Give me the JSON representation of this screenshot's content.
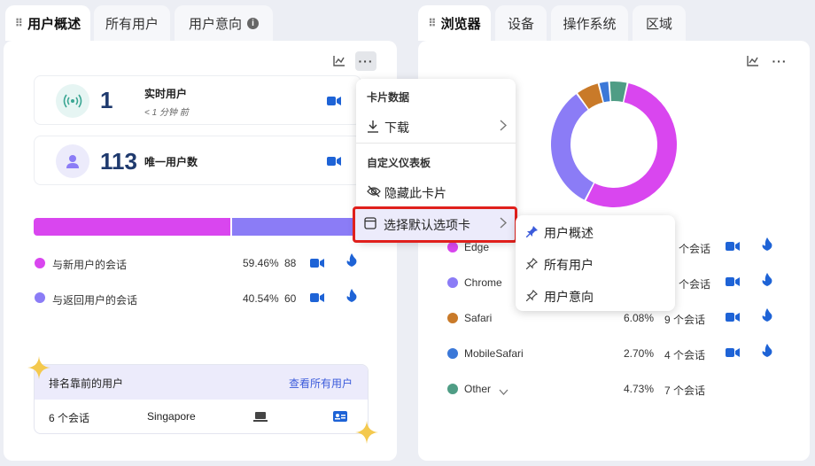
{
  "left_tabs": [
    {
      "label": "用户概述",
      "active": true
    },
    {
      "label": "所有用户",
      "active": false
    },
    {
      "label": "用户意向",
      "active": false
    }
  ],
  "right_tabs": [
    {
      "label": "浏览器",
      "active": true
    },
    {
      "label": "设备",
      "active": false
    },
    {
      "label": "操作系统",
      "active": false
    },
    {
      "label": "区域",
      "active": false
    }
  ],
  "left_card": {
    "realtime": {
      "value": "1",
      "label": "实时用户",
      "sub": "< 1 分钟 前"
    },
    "unique": {
      "value": "113",
      "label": "唯一用户数"
    },
    "bar": {
      "new_share": 59.46,
      "return_share": 40.54,
      "new_color": "#d946ef",
      "return_color": "#8b7cf6"
    },
    "legend": [
      {
        "label": "与新用户的会话",
        "percent": "59.46%",
        "count": "88",
        "color": "#d946ef"
      },
      {
        "label": "与返回用户的会话",
        "percent": "40.54%",
        "count": "60",
        "color": "#8b7cf6"
      }
    ],
    "top_users": {
      "title": "排名靠前的用户",
      "link": "查看所有用户",
      "row": {
        "sessions": "6 个会话",
        "location": "Singapore"
      }
    }
  },
  "right_card": {
    "browsers": [
      {
        "name": "Edge",
        "percent": "",
        "sessions": "个会话",
        "color": "#d946ef"
      },
      {
        "name": "Chrome",
        "percent": "",
        "sessions": "个会话",
        "color": "#8b7cf6"
      },
      {
        "name": "Safari",
        "percent": "6.08%",
        "sessions": "9 个会话",
        "color": "#c97a29"
      },
      {
        "name": "MobileSafari",
        "percent": "2.70%",
        "sessions": "4 个会话",
        "color": "#3b78d8"
      },
      {
        "name": "Other",
        "percent": "4.73%",
        "sessions": "7 个会话",
        "color": "#4f9d85"
      }
    ],
    "donut_shares": [
      54.05,
      32.43,
      6.08,
      2.7,
      4.73
    ]
  },
  "menu": {
    "section1": "卡片数据",
    "download": "下载",
    "section2": "自定义仪表板",
    "hide": "隐藏此卡片",
    "select_default": "选择默认选项卡"
  },
  "submenu": [
    "用户概述",
    "所有用户",
    "用户意向"
  ],
  "colors": {
    "accent": "#3b5bdb",
    "icon_blue": "#1e63d6",
    "highlight_border": "#e0201c"
  }
}
